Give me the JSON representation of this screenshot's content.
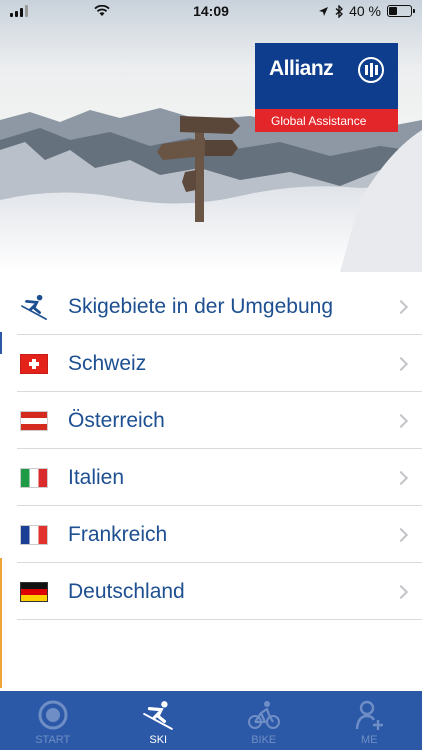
{
  "status_bar": {
    "time": "14:09",
    "battery": "40 %",
    "battery_level": 0.4,
    "icons": [
      "signal-icon",
      "wifi-icon",
      "location-icon",
      "bluetooth-icon",
      "battery-icon"
    ]
  },
  "hero": {
    "brand_name": "Allianz",
    "brand_subtitle": "Global Assistance",
    "colors": {
      "brand_blue": "#0d3d8c",
      "brand_red": "#e3262a"
    }
  },
  "menu": {
    "items": [
      {
        "label": "Skigebiete in der Umgebung",
        "icon": "skier-icon"
      },
      {
        "label": "Schweiz",
        "icon": "swiss-flag-icon"
      },
      {
        "label": "Österreich",
        "icon": "austrian-flag-icon"
      },
      {
        "label": "Italien",
        "icon": "italian-flag-icon"
      },
      {
        "label": "Frankreich",
        "icon": "french-flag-icon"
      },
      {
        "label": "Deutschland",
        "icon": "german-flag-icon"
      }
    ],
    "colors": {
      "label": "#1d4f91",
      "separator": "#d9d9de"
    }
  },
  "tabbar": {
    "tabs": [
      {
        "label": "START",
        "icon": "target-icon",
        "active": false
      },
      {
        "label": "SKI",
        "icon": "skier-icon",
        "active": true
      },
      {
        "label": "BIKE",
        "icon": "bike-icon",
        "active": false
      },
      {
        "label": "ME",
        "icon": "add-person-icon",
        "active": false
      }
    ],
    "colors": {
      "background": "#2b58a7",
      "active": "#ffffff",
      "inactive": "#6f8ec6"
    }
  }
}
